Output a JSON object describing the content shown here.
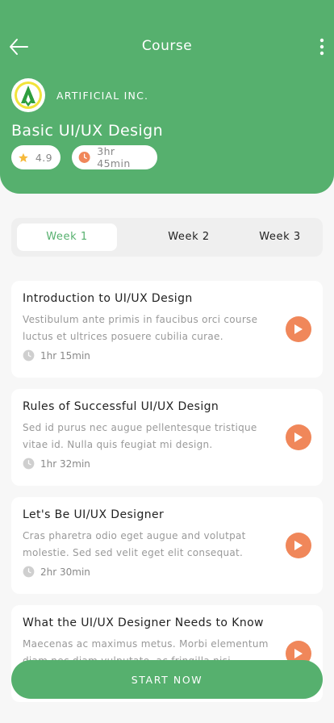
{
  "header": {
    "title": "Course",
    "company": "ARTIFICIAL INC.",
    "course_title": "Basic UI/UX Design",
    "rating": "4.9",
    "duration": "3hr 45min",
    "logo_letter": "A"
  },
  "tabs": [
    {
      "label": "Week 1",
      "active": true
    },
    {
      "label": "Week 2",
      "active": false
    },
    {
      "label": "Week 3",
      "active": false
    }
  ],
  "lessons": [
    {
      "title": "Introduction to UI/UX Design",
      "desc_line1": "Vestibulum ante primis in faucibus orci course",
      "desc_line2": "luctus et ultrices posuere cubilia curae.",
      "time": "1hr 15min"
    },
    {
      "title": "Rules of Successful UI/UX Design",
      "desc_line1": "Sed id purus nec augue pellentesque tristique",
      "desc_line2": "vitae id. Nulla quis feugiat mi design.",
      "time": "1hr 32min"
    },
    {
      "title": "Let's Be UI/UX Designer",
      "desc_line1": "Cras pharetra odio eget augue and volutpat",
      "desc_line2": "molestie. Sed sed velit eget elit consequat.",
      "time": "2hr 30min"
    },
    {
      "title": "What the UI/UX Designer Needs to Know",
      "desc_line1": "Maecenas ac maximus metus. Morbi elementum",
      "desc_line2": "diam nec diam vulputate, ac fringilla nisi.",
      "time": ""
    }
  ],
  "start_button": "START NOW",
  "colors": {
    "primary": "#56b06e",
    "accent": "#f0875a",
    "star": "#f6b93b"
  },
  "icons": [
    "back-arrow-icon",
    "more-vertical-icon",
    "star-icon",
    "clock-icon",
    "play-icon"
  ]
}
